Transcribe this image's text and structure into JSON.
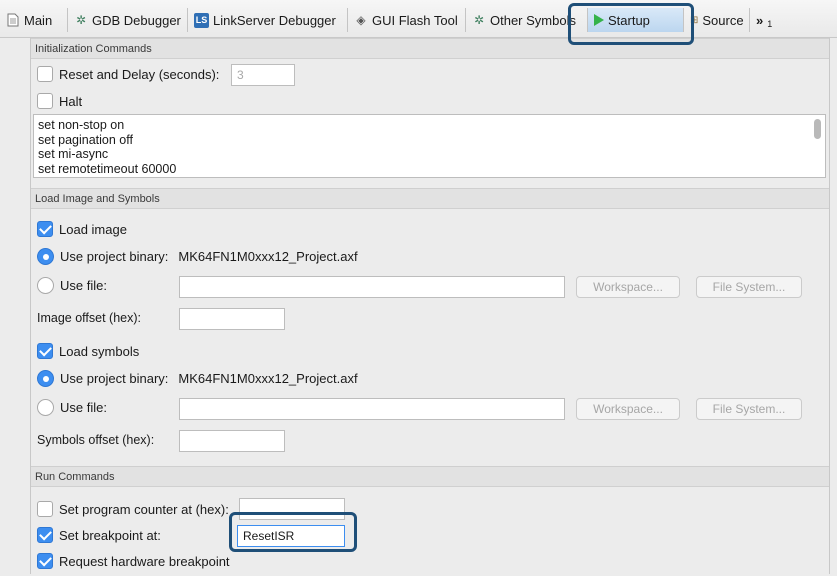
{
  "tabs": [
    {
      "label": "Main",
      "icon": "document-icon"
    },
    {
      "label": "GDB Debugger",
      "icon": "debugger-bug-icon"
    },
    {
      "label": "LinkServer Debugger",
      "icon": "linkserver-badge-icon",
      "badge": "LS"
    },
    {
      "label": "GUI Flash Tool",
      "icon": "flash-chip-icon"
    },
    {
      "label": "Other Symbols",
      "icon": "debugger-bug-icon"
    },
    {
      "label": "Startup",
      "icon": "play-icon",
      "active": true
    },
    {
      "label": "Source",
      "icon": "source-lookup-icon"
    }
  ],
  "tab_overflow": "»",
  "tab_overflow_count": "1",
  "init": {
    "title": "Initialization Commands",
    "reset_label": "Reset and Delay (seconds):",
    "reset_checked": false,
    "reset_value": "3",
    "halt_label": "Halt",
    "halt_checked": false,
    "commands": [
      "set non-stop on",
      "set pagination off",
      "set mi-async",
      "set remotetimeout 60000"
    ]
  },
  "load": {
    "title": "Load Image and Symbols",
    "load_image_label": "Load image",
    "load_image_checked": true,
    "use_project_binary_label": "Use project binary:",
    "project_binary": "MK64FN1M0xxx12_Project.axf",
    "use_file_label": "Use file:",
    "workspace_label": "Workspace...",
    "filesystem_label": "File System...",
    "image_offset_label": "Image offset (hex):",
    "load_symbols_label": "Load symbols",
    "load_symbols_checked": true,
    "symbols_offset_label": "Symbols offset (hex):"
  },
  "run": {
    "title": "Run Commands",
    "set_pc_label": "Set program counter at (hex):",
    "set_pc_checked": false,
    "set_bp_label": "Set breakpoint at:",
    "set_bp_checked": true,
    "bp_value": "ResetISR",
    "hw_bp_label": "Request hardware breakpoint",
    "hw_bp_checked": true
  },
  "colors": {
    "accent": "#3d8ef0",
    "callout": "#1f4f78",
    "startup_play": "#35b34a"
  }
}
